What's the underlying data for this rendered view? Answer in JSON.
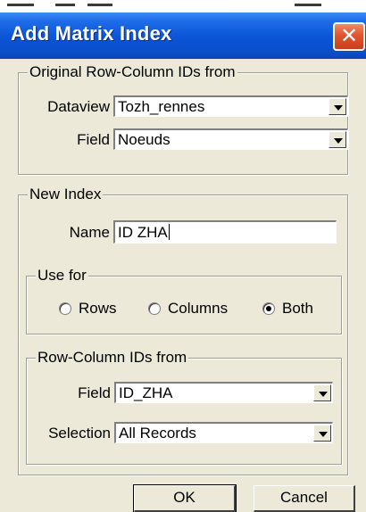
{
  "window": {
    "title": "Add Matrix Index",
    "close_glyph": "✕"
  },
  "original": {
    "legend": "Original Row-Column IDs from",
    "dataview_label": "Dataview",
    "dataview_value": "Tozh_rennes",
    "field_label": "Field",
    "field_value": "Noeuds"
  },
  "new_index": {
    "legend": "New Index",
    "name_label": "Name",
    "name_value": "ID ZHA"
  },
  "use_for": {
    "legend": "Use for",
    "options": [
      {
        "label": "Rows",
        "checked": false
      },
      {
        "label": "Columns",
        "checked": false
      },
      {
        "label": "Both",
        "checked": true
      }
    ]
  },
  "row_col": {
    "legend": "Row-Column IDs from",
    "field_label": "Field",
    "field_value": "ID_ZHA",
    "selection_label": "Selection",
    "selection_value": "All Records"
  },
  "buttons": {
    "ok": "OK",
    "cancel": "Cancel"
  }
}
